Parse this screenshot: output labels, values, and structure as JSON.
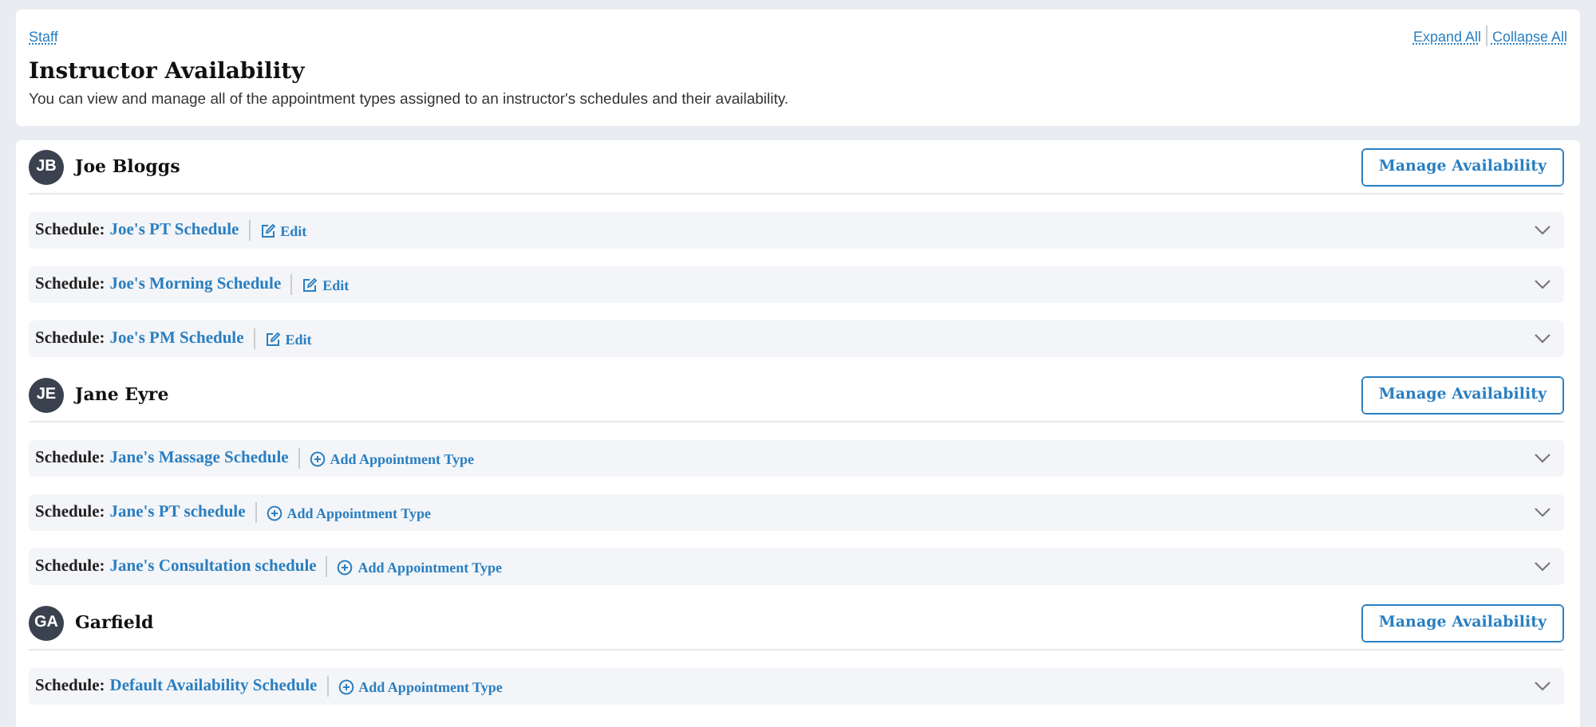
{
  "breadcrumb": "Staff",
  "header_links": [
    "Expand All",
    "Collapse All"
  ],
  "title": "Instructor Availability",
  "description": "You can view and manage all of the appointment types assigned to an instructor's schedules and their availability.",
  "instructors": [
    {
      "initials": "JB",
      "name": "Joe Bloggs",
      "button": "Manage Availability",
      "schedules": [
        {
          "label": "Schedule:",
          "name": "Joe's PT Schedule",
          "action": {
            "kind": "edit",
            "label": "Edit"
          },
          "expanded": false
        },
        {
          "label": "Schedule:",
          "name": "Joe's Morning Schedule",
          "action": {
            "kind": "edit",
            "label": "Edit"
          },
          "expanded": false
        },
        {
          "label": "Schedule:",
          "name": "Joe's PM Schedule",
          "action": {
            "kind": "edit",
            "label": "Edit"
          },
          "expanded": false
        }
      ]
    },
    {
      "initials": "JE",
      "name": "Jane Eyre",
      "button": "Manage Availability",
      "schedules": [
        {
          "label": "Schedule:",
          "name": "Jane's Massage Schedule",
          "action": {
            "kind": "add",
            "label": "Add Appointment Type"
          },
          "expanded": false
        },
        {
          "label": "Schedule:",
          "name": "Jane's PT schedule",
          "action": {
            "kind": "add",
            "label": "Add Appointment Type"
          },
          "expanded": false
        },
        {
          "label": "Schedule:",
          "name": "Jane's Consultation schedule",
          "action": {
            "kind": "add",
            "label": "Add Appointment Type"
          },
          "expanded": false
        }
      ]
    },
    {
      "initials": "GA",
      "name": "Garfield",
      "button": "Manage Availability",
      "schedules": [
        {
          "label": "Schedule:",
          "name": "Default Availability Schedule",
          "action": {
            "kind": "add",
            "label": "Add Appointment Type"
          },
          "expanded": false
        }
      ]
    }
  ]
}
